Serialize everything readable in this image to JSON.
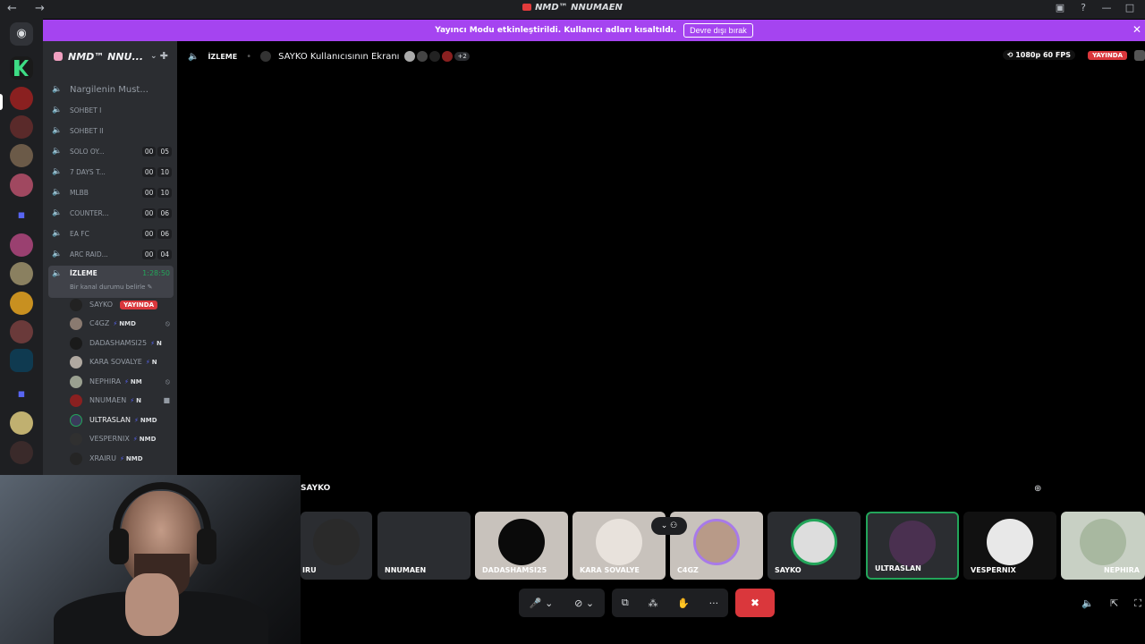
{
  "window": {
    "nav": "← →",
    "title": "NMD™ NNUMAEN",
    "controls": [
      "▣",
      "?",
      "—",
      "□"
    ]
  },
  "banner": {
    "text": "Yayıncı Modu etkinleştirildi. Kullanıcı adları kısaltıldı.",
    "button": "Devre dışı bırak",
    "close": "✕"
  },
  "server": {
    "name": "NMD™ NNU...",
    "chevron": "⌄",
    "add_icon": "✚"
  },
  "channels": [
    {
      "name": "Nargilenin Must...",
      "big": true
    },
    {
      "name": "SOHBET I"
    },
    {
      "name": "SOHBET II"
    },
    {
      "name": "SOLO OY...",
      "counts": [
        "00",
        "05"
      ]
    },
    {
      "name": "7 DAYS T...",
      "counts": [
        "00",
        "10"
      ]
    },
    {
      "name": "MLBB",
      "counts": [
        "00",
        "10"
      ]
    },
    {
      "name": "COUNTER...",
      "counts": [
        "00",
        "06"
      ]
    },
    {
      "name": "EA FC",
      "counts": [
        "00",
        "06"
      ]
    },
    {
      "name": "ARC RAID...",
      "counts": [
        "00",
        "04"
      ]
    }
  ],
  "active_channel": {
    "name": "İZLEME",
    "time": "1:28:50",
    "status": "Bir kanal durumu belirle ✎"
  },
  "members": [
    {
      "name": "SAYKO",
      "live": "YAYINDA"
    },
    {
      "name": "C4GZ",
      "tag": "NMD",
      "mute": "⦸"
    },
    {
      "name": "DADASHAMSI25",
      "tag": "N"
    },
    {
      "name": "KARA SOVALYE",
      "tag": "N"
    },
    {
      "name": "NEPHIRA",
      "tag": "NM",
      "mute": "⦸"
    },
    {
      "name": "NNUMAEN",
      "tag": "N",
      "mute": "■"
    },
    {
      "name": "ULTRASLAN",
      "tag": "NMD",
      "bright": true
    },
    {
      "name": "VESPERNIX",
      "tag": "NMD"
    },
    {
      "name": "XRAIRU",
      "tag": "NMD"
    }
  ],
  "stage": {
    "channel": "İZLEME",
    "title": "SAYKO Kullanıcısının Ekranı",
    "extra": "+2",
    "quality": "⟲ 1080p 60 FPS",
    "live": "YAYINDA"
  },
  "stripe": {
    "label": "SAYKO",
    "zoom_icon": "⊕",
    "tiles": [
      "IRU",
      "NNUMAEN",
      "DADASHAMSI25",
      "KARA SOVALYE",
      "C4GZ",
      "SAYKO",
      "ULTRASLAN",
      "VESPERNIX",
      "NEPHIRA"
    ],
    "tile_ctrl": "⌄ ⚇"
  },
  "controls": {
    "mic": "🎤 ⌄",
    "camera": "⊘ ⌄",
    "share": "⧉",
    "activities": "⁂",
    "soundboard": "✋",
    "more": "···",
    "end": "✖",
    "right": [
      "🔈",
      "⇱",
      "⛶"
    ]
  },
  "colors": {
    "banner": "#a544f0",
    "live": "#da373c",
    "accent": "#5865f2",
    "speaking": "#23a55a"
  }
}
